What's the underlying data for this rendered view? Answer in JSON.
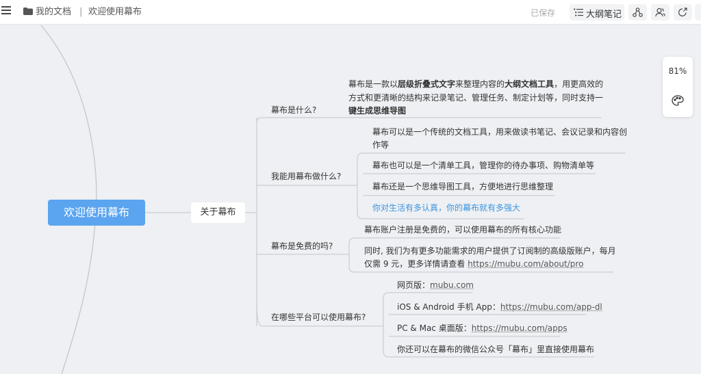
{
  "topbar": {
    "breadcrumb_folder": "我的文档",
    "breadcrumb_sep": "|",
    "breadcrumb_doc": "欢迎使用幕布",
    "saved_status": "已保存",
    "outline_button": "大纲笔记"
  },
  "zoom": {
    "value": "81%"
  },
  "mindmap": {
    "root": "欢迎使用幕布",
    "about": "关于幕布",
    "branches": {
      "what": {
        "title": "幕布是什么?",
        "line1_a": "幕布是一款以",
        "line1_b": "层级折叠式文字",
        "line1_c": "来整理内容的",
        "line1_d": "大纲文档工具",
        "line1_e": "，用更高效的",
        "line2": "方式和更清晰的结构来记录笔记、管理任务、制定计划等，同时支持一",
        "line3": "键生成思维导图"
      },
      "use": {
        "title": "我能用幕布做什么?",
        "item1_l1": "幕布可以是一个传统的文档工具，用来做读书笔记、会议记录和内容创",
        "item1_l2": "作等",
        "item2": "幕布也可以是一个清单工具，管理你的待办事项、购物清单等",
        "item3": "幕布还是一个思维导图工具，方便地进行思维整理",
        "item4": "你对生活有多认真，你的幕布就有多强大"
      },
      "free": {
        "title": "幕布是免费的吗?",
        "item1": "幕布账户注册是免费的，可以使用幕布的所有核心功能",
        "item2_l1": "同时, 我们为有更多功能需求的用户提供了订阅制的高级版账户，每月",
        "item2_l2a": "仅需 9 元，更多详情请查看 ",
        "item2_link": "https://mubu.com/about/pro"
      },
      "platforms": {
        "title": "在哪些平台可以使用幕布?",
        "web_label": "网页版：",
        "web_link": "mubu.com",
        "app_label": "iOS & Android 手机 App：",
        "app_link": "https://mubu.com/app-dl",
        "desktop_label": "PC & Mac 桌面版：",
        "desktop_link": "https://mubu.com/apps",
        "wechat": "你还可以在幕布的微信公众号「幕布」里直接使用幕布"
      }
    }
  },
  "colors": {
    "accent": "#5ba4ef",
    "link_blue": "#3d95e0",
    "line": "#c9ccd1"
  }
}
